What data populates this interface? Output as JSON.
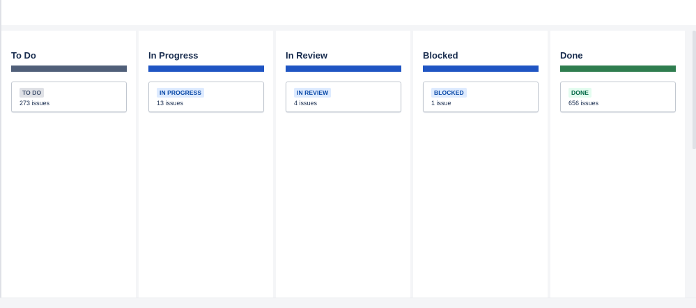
{
  "board": {
    "columns": [
      {
        "title": "To Do",
        "bar_color": "#505f79",
        "lozenge": {
          "label": "TO DO",
          "bg": "#dfe1e6",
          "fg": "#42526e"
        },
        "count": "273 issues"
      },
      {
        "title": "In Progress",
        "bar_color": "#1f55c3",
        "lozenge": {
          "label": "IN PROGRESS",
          "bg": "#deebff",
          "fg": "#0747a6"
        },
        "count": "13 issues"
      },
      {
        "title": "In Review",
        "bar_color": "#1f55c3",
        "lozenge": {
          "label": "IN REVIEW",
          "bg": "#deebff",
          "fg": "#0747a6"
        },
        "count": "4 issues"
      },
      {
        "title": "Blocked",
        "bar_color": "#1f55c3",
        "lozenge": {
          "label": "BLOCKED",
          "bg": "#deebff",
          "fg": "#0747a6"
        },
        "count": "1 issue"
      },
      {
        "title": "Done",
        "bar_color": "#2f7d4f",
        "lozenge": {
          "label": "DONE",
          "bg": "#e3fcef",
          "fg": "#006644"
        },
        "count": "656 issues"
      }
    ]
  }
}
